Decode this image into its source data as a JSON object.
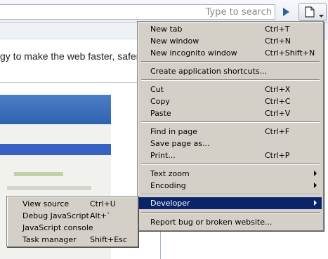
{
  "toolbar": {
    "search_placeholder": "Type to search",
    "go_icon": "play-arrow-icon",
    "page_menu_icon": "page-icon"
  },
  "page": {
    "text": "gy to make the web faster, safer, a"
  },
  "menu": {
    "items": [
      {
        "label": "New tab",
        "shortcut": "Ctrl+T"
      },
      {
        "label": "New window",
        "shortcut": "Ctrl+N"
      },
      {
        "label": "New incognito window",
        "shortcut": "Ctrl+Shift+N"
      },
      {
        "label": "Create application shortcuts...",
        "shortcut": ""
      },
      {
        "label": "Cut",
        "shortcut": "Ctrl+X"
      },
      {
        "label": "Copy",
        "shortcut": "Ctrl+C"
      },
      {
        "label": "Paste",
        "shortcut": "Ctrl+V"
      },
      {
        "label": "Find in page",
        "shortcut": "Ctrl+F"
      },
      {
        "label": "Save page as...",
        "shortcut": ""
      },
      {
        "label": "Print...",
        "shortcut": "Ctrl+P"
      },
      {
        "label": "Text zoom",
        "shortcut": ""
      },
      {
        "label": "Encoding",
        "shortcut": ""
      },
      {
        "label": "Developer",
        "shortcut": ""
      },
      {
        "label": "Report bug or broken website...",
        "shortcut": ""
      }
    ]
  },
  "submenu": {
    "items": [
      {
        "label": "View source",
        "shortcut": "Ctrl+U"
      },
      {
        "label": "Debug JavaScript",
        "shortcut": "Alt+`"
      },
      {
        "label": "JavaScript console",
        "shortcut": ""
      },
      {
        "label": "Task manager",
        "shortcut": "Shift+Esc"
      }
    ]
  },
  "colors": {
    "menu_bg": "#d4d0c8",
    "highlight": "#0a246a"
  }
}
